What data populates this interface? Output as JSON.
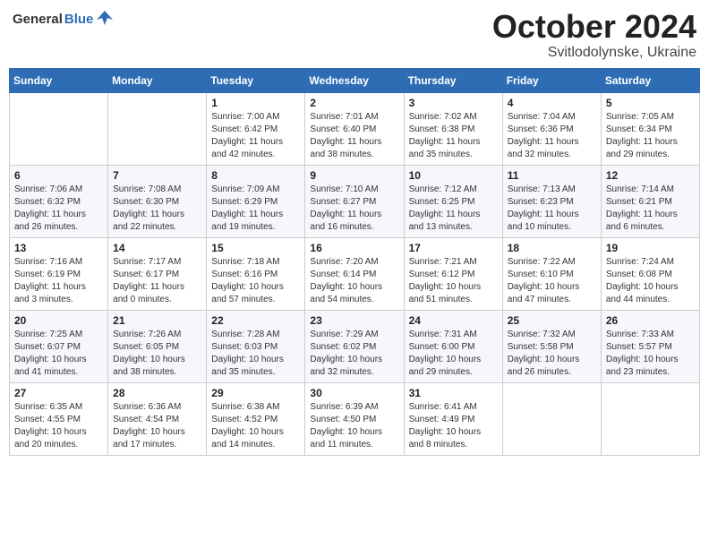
{
  "header": {
    "logo": {
      "text_general": "General",
      "text_blue": "Blue"
    },
    "title": "October 2024",
    "subtitle": "Svitlodolynske, Ukraine"
  },
  "calendar": {
    "days_of_week": [
      "Sunday",
      "Monday",
      "Tuesday",
      "Wednesday",
      "Thursday",
      "Friday",
      "Saturday"
    ],
    "weeks": [
      [
        {
          "day": "",
          "info": ""
        },
        {
          "day": "",
          "info": ""
        },
        {
          "day": "1",
          "info": "Sunrise: 7:00 AM\nSunset: 6:42 PM\nDaylight: 11 hours and 42 minutes."
        },
        {
          "day": "2",
          "info": "Sunrise: 7:01 AM\nSunset: 6:40 PM\nDaylight: 11 hours and 38 minutes."
        },
        {
          "day": "3",
          "info": "Sunrise: 7:02 AM\nSunset: 6:38 PM\nDaylight: 11 hours and 35 minutes."
        },
        {
          "day": "4",
          "info": "Sunrise: 7:04 AM\nSunset: 6:36 PM\nDaylight: 11 hours and 32 minutes."
        },
        {
          "day": "5",
          "info": "Sunrise: 7:05 AM\nSunset: 6:34 PM\nDaylight: 11 hours and 29 minutes."
        }
      ],
      [
        {
          "day": "6",
          "info": "Sunrise: 7:06 AM\nSunset: 6:32 PM\nDaylight: 11 hours and 26 minutes."
        },
        {
          "day": "7",
          "info": "Sunrise: 7:08 AM\nSunset: 6:30 PM\nDaylight: 11 hours and 22 minutes."
        },
        {
          "day": "8",
          "info": "Sunrise: 7:09 AM\nSunset: 6:29 PM\nDaylight: 11 hours and 19 minutes."
        },
        {
          "day": "9",
          "info": "Sunrise: 7:10 AM\nSunset: 6:27 PM\nDaylight: 11 hours and 16 minutes."
        },
        {
          "day": "10",
          "info": "Sunrise: 7:12 AM\nSunset: 6:25 PM\nDaylight: 11 hours and 13 minutes."
        },
        {
          "day": "11",
          "info": "Sunrise: 7:13 AM\nSunset: 6:23 PM\nDaylight: 11 hours and 10 minutes."
        },
        {
          "day": "12",
          "info": "Sunrise: 7:14 AM\nSunset: 6:21 PM\nDaylight: 11 hours and 6 minutes."
        }
      ],
      [
        {
          "day": "13",
          "info": "Sunrise: 7:16 AM\nSunset: 6:19 PM\nDaylight: 11 hours and 3 minutes."
        },
        {
          "day": "14",
          "info": "Sunrise: 7:17 AM\nSunset: 6:17 PM\nDaylight: 11 hours and 0 minutes."
        },
        {
          "day": "15",
          "info": "Sunrise: 7:18 AM\nSunset: 6:16 PM\nDaylight: 10 hours and 57 minutes."
        },
        {
          "day": "16",
          "info": "Sunrise: 7:20 AM\nSunset: 6:14 PM\nDaylight: 10 hours and 54 minutes."
        },
        {
          "day": "17",
          "info": "Sunrise: 7:21 AM\nSunset: 6:12 PM\nDaylight: 10 hours and 51 minutes."
        },
        {
          "day": "18",
          "info": "Sunrise: 7:22 AM\nSunset: 6:10 PM\nDaylight: 10 hours and 47 minutes."
        },
        {
          "day": "19",
          "info": "Sunrise: 7:24 AM\nSunset: 6:08 PM\nDaylight: 10 hours and 44 minutes."
        }
      ],
      [
        {
          "day": "20",
          "info": "Sunrise: 7:25 AM\nSunset: 6:07 PM\nDaylight: 10 hours and 41 minutes."
        },
        {
          "day": "21",
          "info": "Sunrise: 7:26 AM\nSunset: 6:05 PM\nDaylight: 10 hours and 38 minutes."
        },
        {
          "day": "22",
          "info": "Sunrise: 7:28 AM\nSunset: 6:03 PM\nDaylight: 10 hours and 35 minutes."
        },
        {
          "day": "23",
          "info": "Sunrise: 7:29 AM\nSunset: 6:02 PM\nDaylight: 10 hours and 32 minutes."
        },
        {
          "day": "24",
          "info": "Sunrise: 7:31 AM\nSunset: 6:00 PM\nDaylight: 10 hours and 29 minutes."
        },
        {
          "day": "25",
          "info": "Sunrise: 7:32 AM\nSunset: 5:58 PM\nDaylight: 10 hours and 26 minutes."
        },
        {
          "day": "26",
          "info": "Sunrise: 7:33 AM\nSunset: 5:57 PM\nDaylight: 10 hours and 23 minutes."
        }
      ],
      [
        {
          "day": "27",
          "info": "Sunrise: 6:35 AM\nSunset: 4:55 PM\nDaylight: 10 hours and 20 minutes."
        },
        {
          "day": "28",
          "info": "Sunrise: 6:36 AM\nSunset: 4:54 PM\nDaylight: 10 hours and 17 minutes."
        },
        {
          "day": "29",
          "info": "Sunrise: 6:38 AM\nSunset: 4:52 PM\nDaylight: 10 hours and 14 minutes."
        },
        {
          "day": "30",
          "info": "Sunrise: 6:39 AM\nSunset: 4:50 PM\nDaylight: 10 hours and 11 minutes."
        },
        {
          "day": "31",
          "info": "Sunrise: 6:41 AM\nSunset: 4:49 PM\nDaylight: 10 hours and 8 minutes."
        },
        {
          "day": "",
          "info": ""
        },
        {
          "day": "",
          "info": ""
        }
      ]
    ]
  }
}
